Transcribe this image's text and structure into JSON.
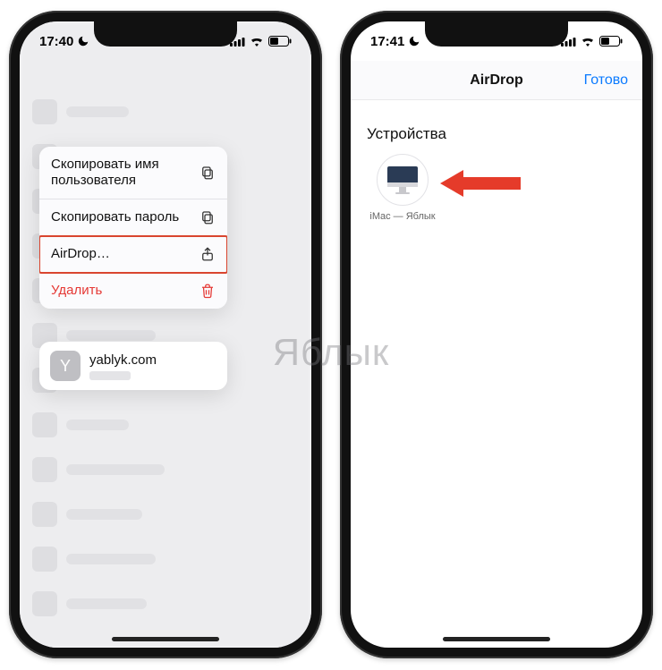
{
  "watermark": "Яблык",
  "left": {
    "status": {
      "time": "17:40"
    },
    "menu": {
      "copy_username": "Скопировать имя пользователя",
      "copy_password": "Скопировать пароль",
      "airdrop": "AirDrop…",
      "delete": "Удалить"
    },
    "site_card": {
      "letter": "Y",
      "domain": "yablyk.com"
    }
  },
  "right": {
    "status": {
      "time": "17:41"
    },
    "nav": {
      "title": "AirDrop",
      "done": "Готово"
    },
    "section": "Устройства",
    "device": {
      "name": "iMac — Яблык"
    }
  }
}
